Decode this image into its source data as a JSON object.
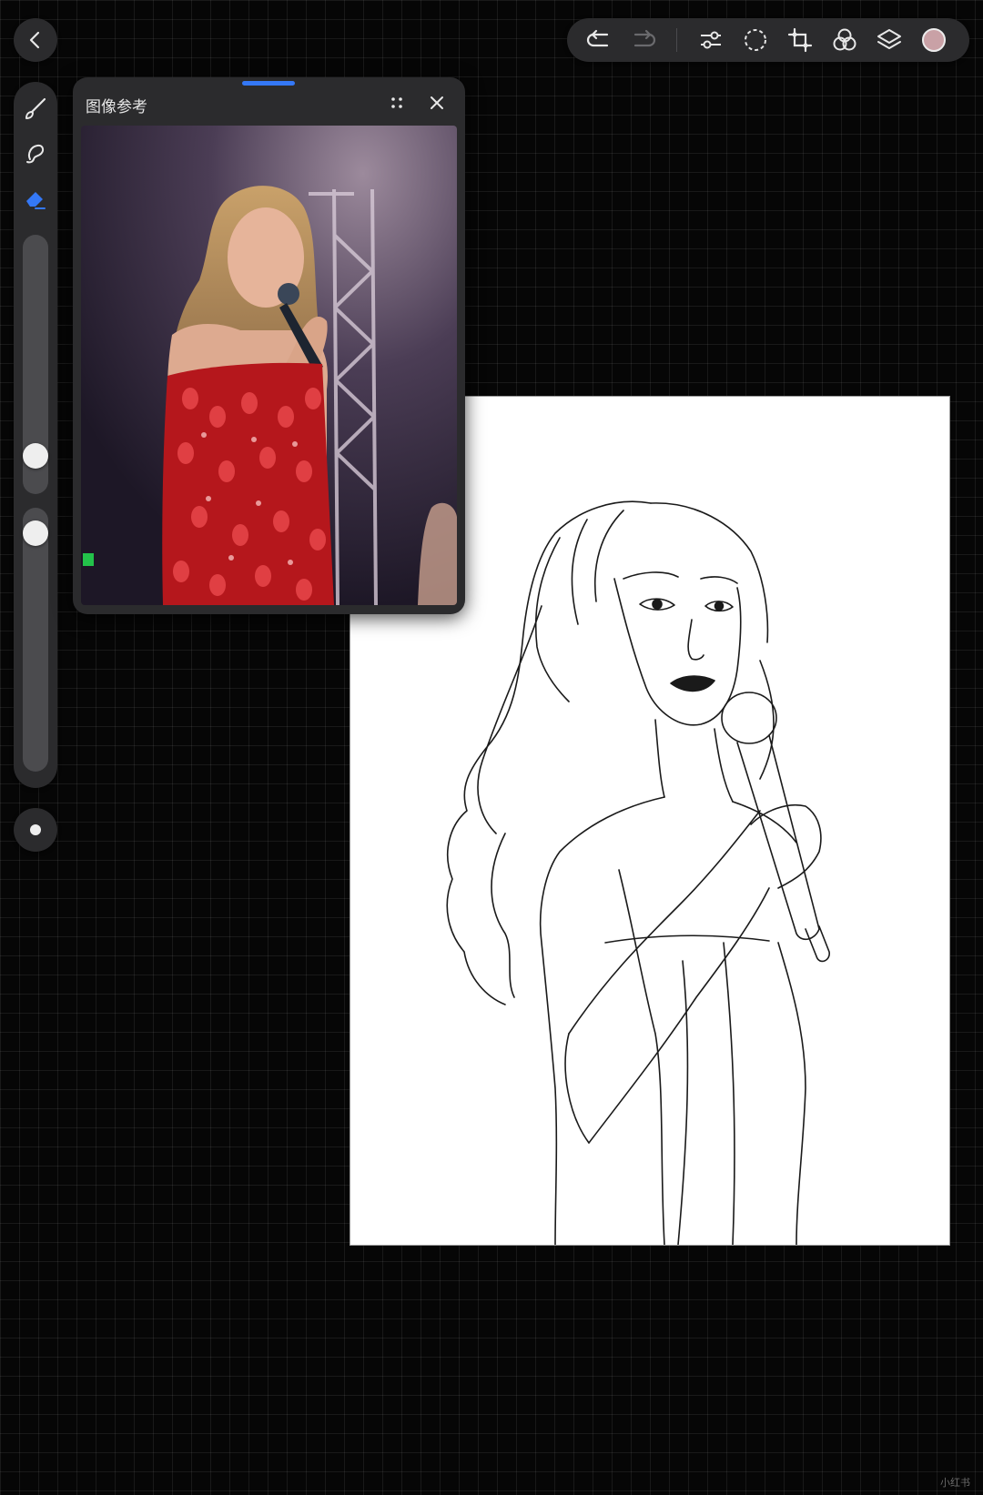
{
  "toolbar": {
    "icons": [
      "undo-icon",
      "redo-icon",
      "adjustments-icon",
      "selection-icon",
      "transform-icon",
      "blend-icon",
      "layers-icon"
    ],
    "current_color": "#c9a1a6"
  },
  "tool_rail": {
    "tools": [
      "brush-icon",
      "smudge-icon",
      "eraser-icon"
    ],
    "active_tool": "eraser",
    "accent_color": "#3478f6",
    "brush_size_level": 0.15,
    "opacity_level": 1.0
  },
  "reference_panel": {
    "title": "图像参考"
  },
  "watermark": {
    "text": "小红书"
  }
}
